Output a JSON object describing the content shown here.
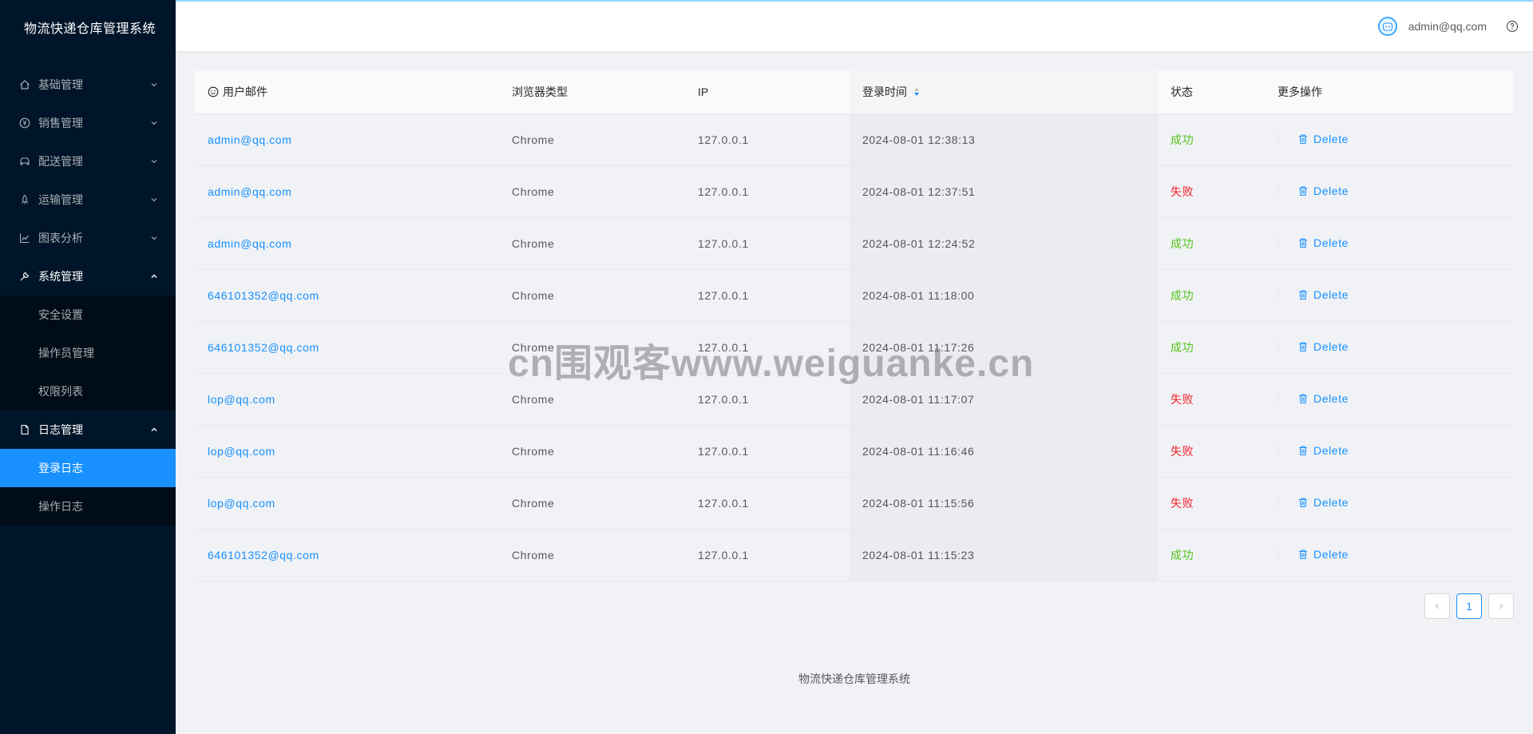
{
  "sidebar": {
    "logo": "物流快递仓库管理系统",
    "items": [
      {
        "label": "基础管理",
        "icon": "home-icon"
      },
      {
        "label": "销售管理",
        "icon": "yuan-circle-icon"
      },
      {
        "label": "配送管理",
        "icon": "car-icon"
      },
      {
        "label": "运输管理",
        "icon": "rocket-icon"
      },
      {
        "label": "图表分析",
        "icon": "line-chart-icon"
      },
      {
        "label": "系统管理",
        "icon": "tool-icon"
      },
      {
        "label": "日志管理",
        "icon": "file-icon"
      }
    ],
    "system_sub": [
      "安全设置",
      "操作员管理",
      "权限列表"
    ],
    "log_sub": [
      "登录日志",
      "操作日志"
    ]
  },
  "header": {
    "user_email": "admin@qq.com"
  },
  "table": {
    "columns": [
      "用户邮件",
      "浏览器类型",
      "IP",
      "登录时间",
      "状态",
      "更多操作"
    ],
    "delete_label": "Delete",
    "rows": [
      {
        "email": "admin@qq.com",
        "browser": "Chrome",
        "ip": "127.0.0.1",
        "time": "2024-08-01 12:38:13",
        "status": "成功",
        "ok": true
      },
      {
        "email": "admin@qq.com",
        "browser": "Chrome",
        "ip": "127.0.0.1",
        "time": "2024-08-01 12:37:51",
        "status": "失败",
        "ok": false
      },
      {
        "email": "admin@qq.com",
        "browser": "Chrome",
        "ip": "127.0.0.1",
        "time": "2024-08-01 12:24:52",
        "status": "成功",
        "ok": true
      },
      {
        "email": "646101352@qq.com",
        "browser": "Chrome",
        "ip": "127.0.0.1",
        "time": "2024-08-01 11:18:00",
        "status": "成功",
        "ok": true
      },
      {
        "email": "646101352@qq.com",
        "browser": "Chrome",
        "ip": "127.0.0.1",
        "time": "2024-08-01 11:17:26",
        "status": "成功",
        "ok": true
      },
      {
        "email": "lop@qq.com",
        "browser": "Chrome",
        "ip": "127.0.0.1",
        "time": "2024-08-01 11:17:07",
        "status": "失败",
        "ok": false
      },
      {
        "email": "lop@qq.com",
        "browser": "Chrome",
        "ip": "127.0.0.1",
        "time": "2024-08-01 11:16:46",
        "status": "失败",
        "ok": false
      },
      {
        "email": "lop@qq.com",
        "browser": "Chrome",
        "ip": "127.0.0.1",
        "time": "2024-08-01 11:15:56",
        "status": "失败",
        "ok": false
      },
      {
        "email": "646101352@qq.com",
        "browser": "Chrome",
        "ip": "127.0.0.1",
        "time": "2024-08-01 11:15:23",
        "status": "成功",
        "ok": true
      }
    ]
  },
  "pagination": {
    "current": "1"
  },
  "footer": "物流快递仓库管理系统",
  "watermark": "cn围观客www.weiguanke.cn",
  "colors": {
    "sidebar_bg": "#001529",
    "accent": "#1890ff",
    "success": "#52c41a",
    "fail": "#f5222d"
  }
}
